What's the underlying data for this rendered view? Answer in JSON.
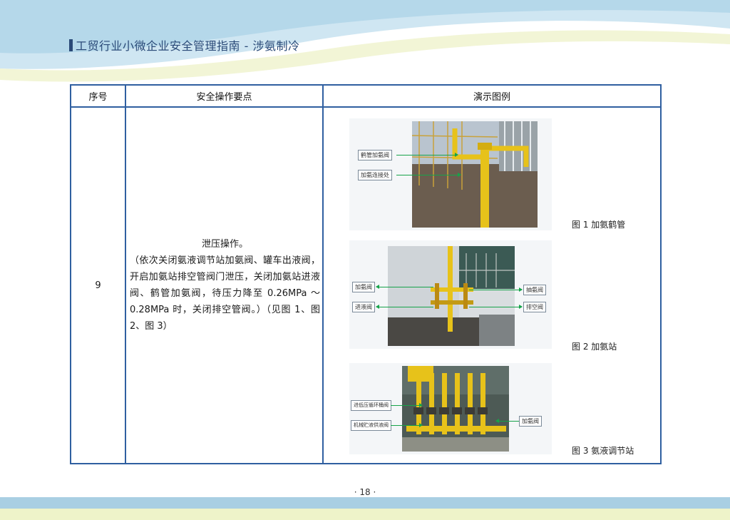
{
  "header": {
    "title": "工贸行业小微企业安全管理指南 - 涉氨制冷"
  },
  "table": {
    "headers": [
      "序号",
      "安全操作要点",
      "演示图例"
    ],
    "row": {
      "number": "9",
      "op_title": "泄压操作。",
      "op_body": "（依次关闭氨液调节站加氨阀、罐车出液阀，开启加氨站排空管阀门泄压，关闭加氨站进液阀、鹤管加氨阀，待压力降至 0.26MPa ～ 0.28MPa 时，关闭排空管阀。）（见图 1、图 2、图 3）"
    }
  },
  "figures": [
    {
      "caption": "图 1  加氨鹤管",
      "labels": [
        "鹤管加氨阀",
        "加氨连接处"
      ]
    },
    {
      "caption": "图 2  加氨站",
      "labels": [
        "加氨阀",
        "进液阀",
        "抽氨阀",
        "排空阀"
      ]
    },
    {
      "caption": "图 3  氨液调节站",
      "labels": [
        "进低压循环桶阀",
        "机械贮液供液阀",
        "加氨阀"
      ]
    }
  ],
  "page_number": "· 18 ·",
  "colors": {
    "table_border": "#2f5fa0",
    "title": "#2a4a78",
    "arrow": "#17a34a"
  }
}
